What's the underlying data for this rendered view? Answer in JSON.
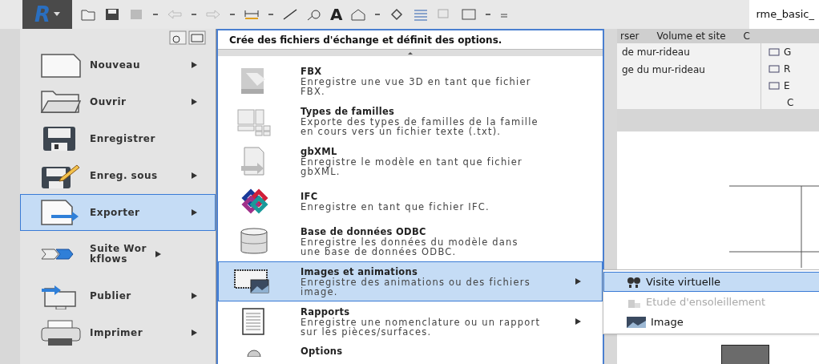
{
  "toolbar": {
    "logo": "R",
    "text_tool": "A",
    "document_title": "rme_basic_"
  },
  "ribbon": {
    "tabs": [
      {
        "label": "rser",
        "selected": false
      },
      {
        "label": "Volume et site",
        "selected": false
      },
      {
        "label": "C",
        "selected": false
      }
    ],
    "left_items": [
      "de mur-rideau",
      "ge du mur-rideau"
    ],
    "right_items": [
      "G",
      "R",
      "E"
    ],
    "panel_label": "C"
  },
  "app_menu": {
    "items": [
      {
        "label": "Nouveau",
        "kind": "new",
        "has_submenu": true,
        "selected": false
      },
      {
        "label": "Ouvrir",
        "kind": "open",
        "has_submenu": true,
        "selected": false
      },
      {
        "label": "Enregistrer",
        "kind": "save",
        "has_submenu": false,
        "selected": false
      },
      {
        "label": "Enreg. sous",
        "kind": "saveas",
        "has_submenu": true,
        "selected": false
      },
      {
        "label": "Exporter",
        "kind": "export",
        "has_submenu": true,
        "selected": true
      },
      {
        "label": "Suite Workflows",
        "kind": "workflow",
        "has_submenu": true,
        "selected": false
      },
      {
        "label": "Publier",
        "kind": "publish",
        "has_submenu": true,
        "selected": false
      },
      {
        "label": "Imprimer",
        "kind": "print",
        "has_submenu": true,
        "selected": false
      }
    ]
  },
  "export_panel": {
    "header": "Crée des fichiers d'échange et définit des options.",
    "items": [
      {
        "title": "FBX",
        "description": "Enregistre une vue 3D en tant que fichier FBX.",
        "kind": "fbx",
        "has_submenu": false,
        "selected": false
      },
      {
        "title": "Types de familles",
        "description": "Exporte des types de familles de la famille en cours vers un fichier texte (.txt).",
        "kind": "families",
        "has_submenu": false,
        "selected": false
      },
      {
        "title": "gbXML",
        "description": "Enregistre le modèle en tant que fichier gbXML.",
        "kind": "gbxml",
        "has_submenu": false,
        "selected": false
      },
      {
        "title": "IFC",
        "description": "Enregistre en tant que fichier IFC.",
        "kind": "ifc",
        "has_submenu": false,
        "selected": false
      },
      {
        "title": "Base de données ODBC",
        "description": "Enregistre les données du modèle dans une base de données ODBC.",
        "kind": "db",
        "has_submenu": false,
        "selected": false
      },
      {
        "title": "Images et animations",
        "description": "Enregistre des animations ou des fichiers image.",
        "kind": "film",
        "has_submenu": true,
        "selected": true
      },
      {
        "title": "Rapports",
        "description": "Enregistre une nomenclature ou un rapport sur les pièces/surfaces.",
        "kind": "report",
        "has_submenu": true,
        "selected": false
      },
      {
        "title": "Options",
        "kind": "options",
        "has_submenu": false,
        "selected": false
      }
    ]
  },
  "submenu": {
    "items": [
      {
        "label": "Visite virtuelle",
        "kind": "walk",
        "selected": true,
        "disabled": false
      },
      {
        "label": "Etude d'ensoleillement",
        "kind": "sun",
        "selected": false,
        "disabled": true
      },
      {
        "label": "Image",
        "kind": "image",
        "selected": false,
        "disabled": false
      }
    ]
  }
}
